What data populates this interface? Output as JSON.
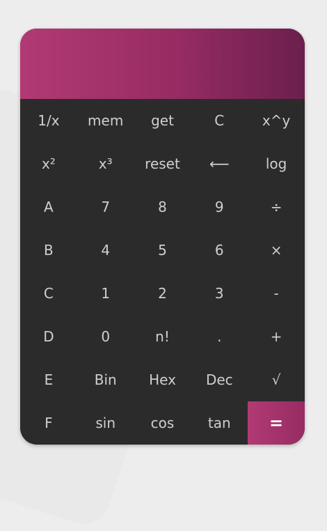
{
  "display": {
    "value": ""
  },
  "keys": [
    "1/x",
    "mem",
    "get",
    "C",
    "x^y",
    "x²",
    "x³",
    "reset",
    "⟵",
    "log",
    "A",
    "7",
    "8",
    "9",
    "÷",
    "B",
    "4",
    "5",
    "6",
    "×",
    "C",
    "1",
    "2",
    "3",
    "-",
    "D",
    "0",
    "n!",
    ".",
    "+",
    "E",
    "Bin",
    "Hex",
    "Dec",
    "√",
    "F",
    "sin",
    "cos",
    "tan",
    "="
  ],
  "colors": {
    "accent_start": "#b23a74",
    "accent_end": "#6b1f4d",
    "keypad_bg": "#2b2b2b",
    "key_text": "#cfcfcf"
  }
}
